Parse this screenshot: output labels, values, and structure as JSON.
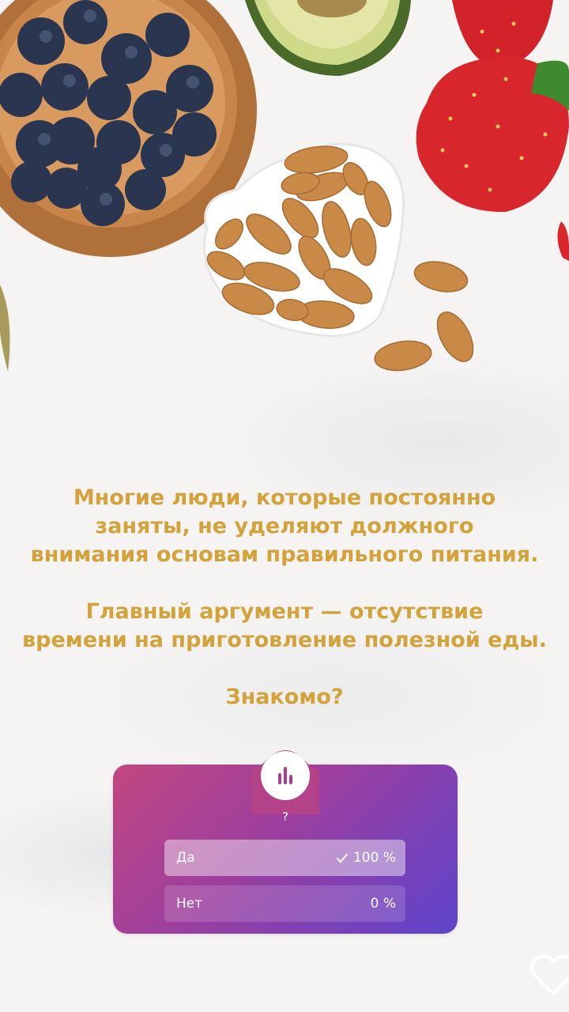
{
  "story": {
    "paragraphs": [
      [
        "Многие люди, которые постоянно",
        "заняты, не уделяют должного",
        "внимания основам правильного питания."
      ],
      [
        "Главный аргумент — отсутствие",
        "времени на приготовление полезной еды."
      ],
      [
        "Знакомо?"
      ]
    ]
  },
  "poll": {
    "question": "?",
    "options": [
      {
        "label": "Да",
        "result": "100 %",
        "fraction": 1.0,
        "selected": true
      },
      {
        "label": "Нет",
        "result": "0 %",
        "fraction": 0.0,
        "selected": false
      }
    ]
  },
  "colors": {
    "text_accent": "#d4a23a",
    "poll_gradient_start": "#c2477f",
    "poll_gradient_end": "#5d44cc"
  },
  "icons": {
    "poll": "bar-chart-icon",
    "check": "check-icon",
    "like": "heart-icon"
  }
}
